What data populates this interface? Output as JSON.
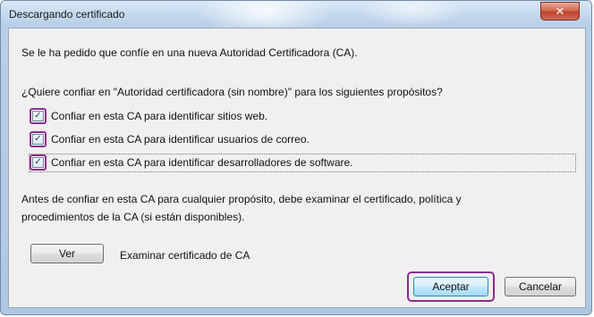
{
  "window": {
    "title": "Descargando certificado",
    "close_glyph": "✕"
  },
  "dialog": {
    "intro": "Se le ha pedido que confíe en una nueva Autoridad Certificadora (CA).",
    "question": "¿Quiere confiar en \"Autoridad certificadora (sin nombre)\" para los siguientes propósitos?",
    "checkboxes": [
      {
        "label": "Confiar en esta CA para identificar sitios web.",
        "checked": true
      },
      {
        "label": "Confiar en esta CA para identificar usuarios de correo.",
        "checked": true
      },
      {
        "label": "Confiar en esta CA para identificar desarrolladores de software.",
        "checked": true
      }
    ],
    "check_glyph": "✓",
    "warning_line1": "Antes de confiar en esta CA para cualquier propósito, debe examinar el certificado, política y",
    "warning_line2": "procedimientos de la CA (si están disponibles).",
    "view_button": "Ver",
    "view_description": "Examinar certificado de CA",
    "accept_button": "Aceptar",
    "cancel_button": "Cancelar"
  },
  "colors": {
    "highlight": "#8a2d8f",
    "close_button": "#c0442c",
    "titlebar": "#c3d8ed"
  }
}
